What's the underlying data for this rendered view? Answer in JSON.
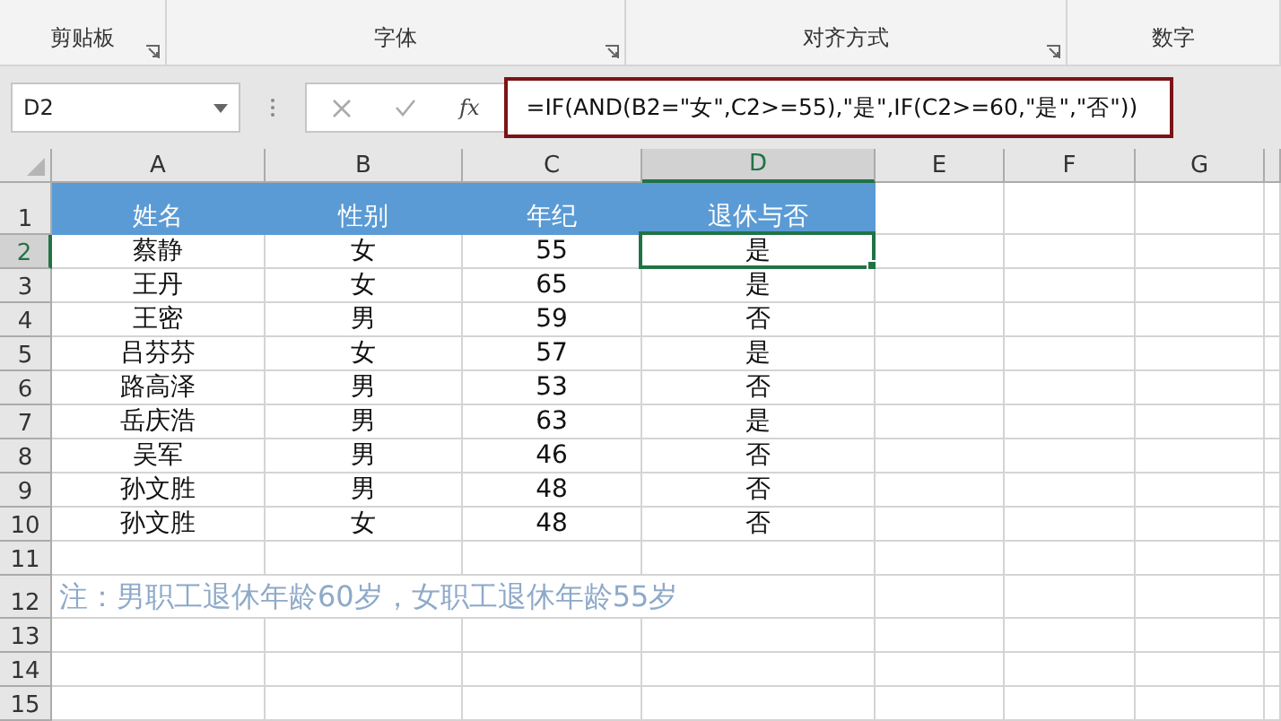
{
  "ribbon": {
    "groups": [
      {
        "label": "剪贴板",
        "launcher": true
      },
      {
        "label": "字体",
        "launcher": true
      },
      {
        "label": "对齐方式",
        "launcher": true
      },
      {
        "label": "数字",
        "launcher": false
      }
    ]
  },
  "formula_bar": {
    "name_box": "D2",
    "fx": "fx",
    "formula": "=IF(AND(B2=\"女\",C2>=55),\"是\",IF(C2>=60,\"是\",\"否\"))"
  },
  "columns": [
    {
      "label": "A",
      "selected": false
    },
    {
      "label": "B",
      "selected": false
    },
    {
      "label": "C",
      "selected": false
    },
    {
      "label": "D",
      "selected": true
    },
    {
      "label": "E",
      "selected": false
    },
    {
      "label": "F",
      "selected": false
    },
    {
      "label": "G",
      "selected": false
    }
  ],
  "rows": [
    {
      "number": "1",
      "kind": "header",
      "selected": false,
      "cells": [
        "姓名",
        "性别",
        "年纪",
        "退休与否"
      ]
    },
    {
      "number": "2",
      "kind": "data",
      "selected": true,
      "cells": [
        "蔡静",
        "女",
        "55",
        "是"
      ]
    },
    {
      "number": "3",
      "kind": "data",
      "selected": false,
      "cells": [
        "王丹",
        "女",
        "65",
        "是"
      ]
    },
    {
      "number": "4",
      "kind": "data",
      "selected": false,
      "cells": [
        "王密",
        "男",
        "59",
        "否"
      ]
    },
    {
      "number": "5",
      "kind": "data",
      "selected": false,
      "cells": [
        "吕芬芬",
        "女",
        "57",
        "是"
      ]
    },
    {
      "number": "6",
      "kind": "data",
      "selected": false,
      "cells": [
        "路高泽",
        "男",
        "53",
        "否"
      ]
    },
    {
      "number": "7",
      "kind": "data",
      "selected": false,
      "cells": [
        "岳庆浩",
        "男",
        "63",
        "是"
      ]
    },
    {
      "number": "8",
      "kind": "data",
      "selected": false,
      "cells": [
        "吴军",
        "男",
        "46",
        "否"
      ]
    },
    {
      "number": "9",
      "kind": "data",
      "selected": false,
      "cells": [
        "孙文胜",
        "男",
        "48",
        "否"
      ]
    },
    {
      "number": "10",
      "kind": "data",
      "selected": false,
      "cells": [
        "孙文胜",
        "女",
        "48",
        "否"
      ]
    },
    {
      "number": "11",
      "kind": "empty",
      "selected": false
    },
    {
      "number": "12",
      "kind": "note",
      "selected": false,
      "text": "注：男职工退休年龄60岁，女职工退休年龄55岁"
    },
    {
      "number": "13",
      "kind": "empty",
      "selected": false
    },
    {
      "number": "14",
      "kind": "empty",
      "selected": false
    },
    {
      "number": "15",
      "kind": "empty",
      "selected": false
    }
  ]
}
